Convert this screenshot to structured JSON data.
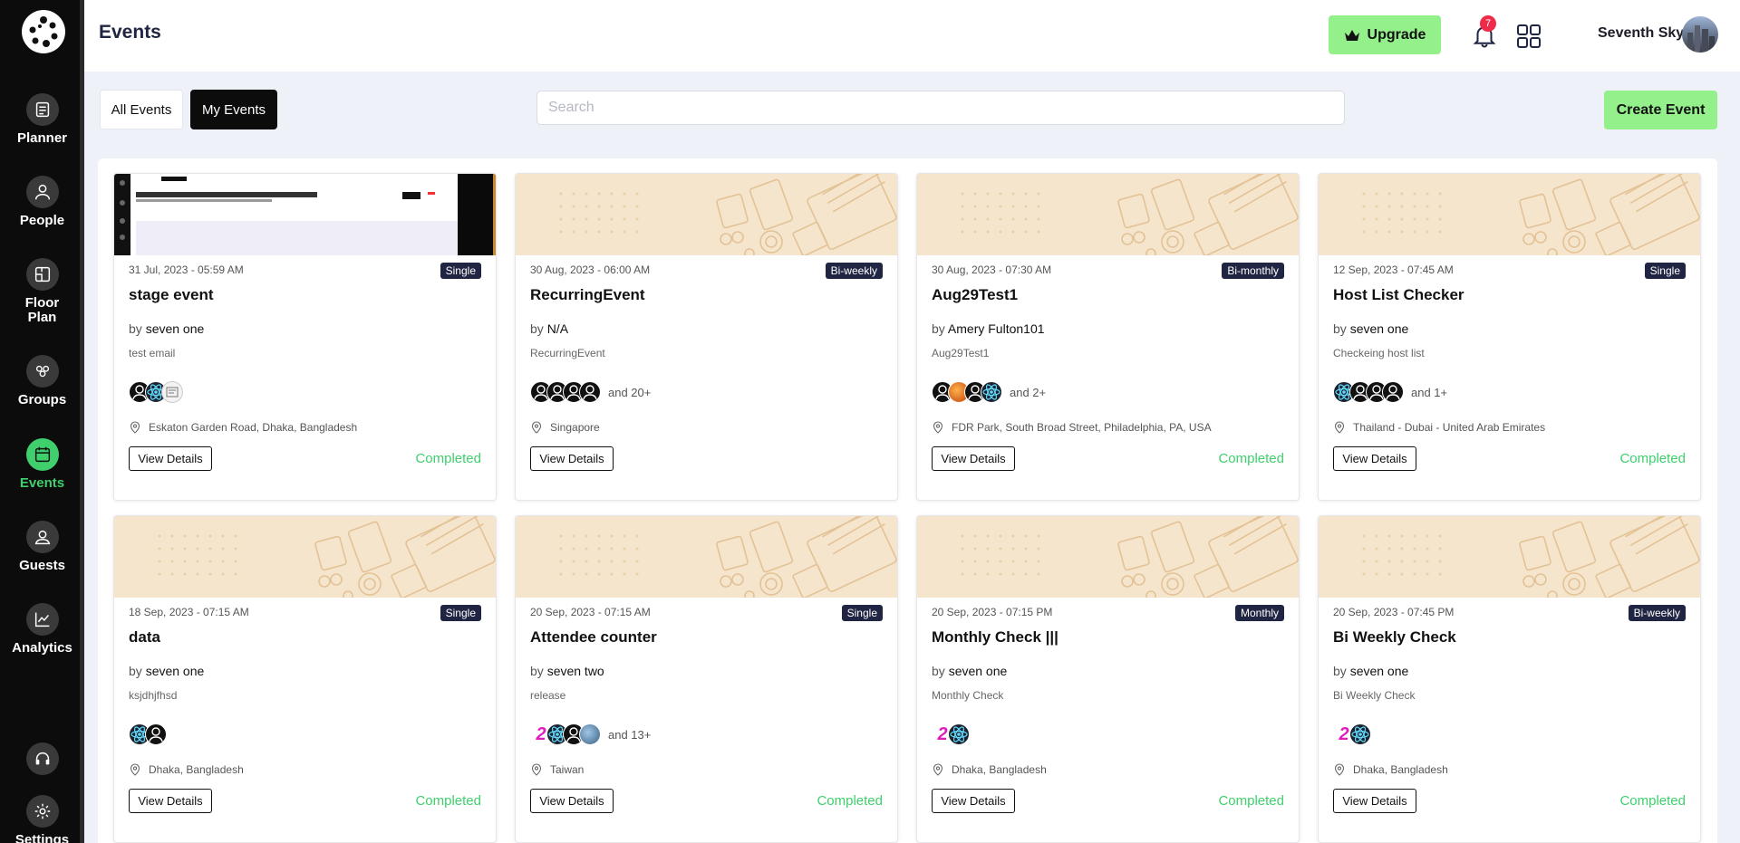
{
  "sidebar": {
    "items": [
      {
        "label": "Planner",
        "icon": "checklist-icon"
      },
      {
        "label": "People",
        "icon": "person-icon"
      },
      {
        "label": "Floor Plan",
        "icon": "floorplan-icon"
      },
      {
        "label": "Groups",
        "icon": "groups-icon"
      },
      {
        "label": "Events",
        "icon": "calendar-icon",
        "active": true
      },
      {
        "label": "Guests",
        "icon": "guests-icon"
      },
      {
        "label": "Analytics",
        "icon": "chart-icon"
      },
      {
        "label": "",
        "icon": "headset-icon"
      },
      {
        "label": "Settings",
        "icon": "gear-icon"
      }
    ]
  },
  "header": {
    "title": "Events",
    "upgrade_label": "Upgrade",
    "notification_count": "7",
    "user_name": "Seventh Sky"
  },
  "toolbar": {
    "tab_all": "All Events",
    "tab_my": "My Events",
    "search_placeholder": "Search",
    "create_label": "Create Event"
  },
  "colors": {
    "accent_green": "#94f08a",
    "status_green": "#3fcf6c",
    "badge_navy": "#1f2542",
    "notification_red": "#ef2b4a"
  },
  "cards": [
    {
      "date": "31 Jul, 2023 - 05:59 AM",
      "badge": "Single",
      "title": "stage event",
      "by_prefix": "by",
      "by": "seven one",
      "desc": "test email",
      "avatars": [
        "person",
        "react",
        "light"
      ],
      "more": "",
      "location": "Eskaton Garden Road, Dhaka, Bangladesh",
      "button": "View Details",
      "status": "Completed",
      "image": "screenshot"
    },
    {
      "date": "30 Aug, 2023 - 06:00 AM",
      "badge": "Bi-weekly",
      "title": "RecurringEvent",
      "by_prefix": "by",
      "by": "N/A",
      "desc": "RecurringEvent",
      "avatars": [
        "person",
        "person",
        "person",
        "person"
      ],
      "more": "and 20+",
      "location": "Singapore",
      "button": "View Details",
      "status": "",
      "image": "desk"
    },
    {
      "date": "30 Aug, 2023 - 07:30 AM",
      "badge": "Bi-monthly",
      "title": "Aug29Test1",
      "by_prefix": "by",
      "by": "Amery Fulton101",
      "desc": "Aug29Test1",
      "avatars": [
        "person",
        "fire",
        "person",
        "react"
      ],
      "more": "and 2+",
      "location": "FDR Park, South Broad Street, Philadelphia, PA, USA",
      "button": "View Details",
      "status": "Completed",
      "image": "desk"
    },
    {
      "date": "12 Sep, 2023 - 07:45 AM",
      "badge": "Single",
      "title": "Host List Checker",
      "by_prefix": "by",
      "by": "seven one",
      "desc": "Checkeing host list",
      "avatars": [
        "react",
        "person",
        "person",
        "person"
      ],
      "more": "and 1+",
      "location": "Thailand - Dubai - United Arab Emirates",
      "button": "View Details",
      "status": "Completed",
      "image": "desk"
    },
    {
      "date": "18 Sep, 2023 - 07:15 AM",
      "badge": "Single",
      "title": "data",
      "by_prefix": "by",
      "by": "seven one",
      "desc": "ksjdhjfhsd",
      "avatars": [
        "react",
        "person"
      ],
      "more": "",
      "location": "Dhaka, Bangladesh",
      "button": "View Details",
      "status": "Completed",
      "image": "desk"
    },
    {
      "date": "20 Sep, 2023 - 07:15 AM",
      "badge": "Single",
      "title": "Attendee counter",
      "by_prefix": "by",
      "by": "seven two",
      "desc": "release",
      "avatars": [
        "two",
        "react",
        "person",
        "globe"
      ],
      "more": "and 13+",
      "location": "Taiwan",
      "button": "View Details",
      "status": "Completed",
      "image": "desk"
    },
    {
      "date": "20 Sep, 2023 - 07:15 PM",
      "badge": "Monthly",
      "title": "Monthly Check |||",
      "by_prefix": "by",
      "by": "seven one",
      "desc": "Monthly Check",
      "avatars": [
        "two",
        "react"
      ],
      "more": "",
      "location": "Dhaka, Bangladesh",
      "button": "View Details",
      "status": "Completed",
      "image": "desk"
    },
    {
      "date": "20 Sep, 2023 - 07:45 PM",
      "badge": "Bi-weekly",
      "title": "Bi Weekly Check",
      "by_prefix": "by",
      "by": "seven one",
      "desc": "Bi Weekly Check",
      "avatars": [
        "two",
        "react"
      ],
      "more": "",
      "location": "Dhaka, Bangladesh",
      "button": "View Details",
      "status": "Completed",
      "image": "desk"
    }
  ]
}
